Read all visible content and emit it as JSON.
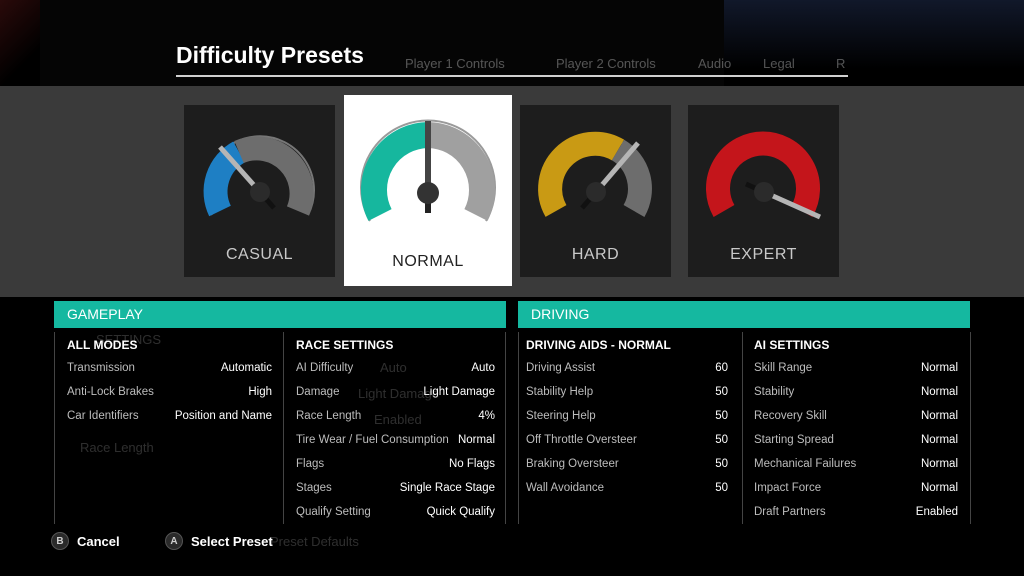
{
  "page": {
    "title": "Difficulty Presets"
  },
  "background": {
    "tabs": [
      "Player 1 Controls",
      "Player 2 Controls",
      "Audio",
      "Legal",
      "R"
    ],
    "ghost_texts": [
      "SETTINGS",
      "Auto",
      "Light Damage",
      "Enabled",
      "Race Length",
      "Preset Defaults"
    ]
  },
  "presets": [
    {
      "label": "CASUAL",
      "color": "#1e7fc4",
      "selected": false
    },
    {
      "label": "NORMAL",
      "color": "#16b79e",
      "selected": true
    },
    {
      "label": "HARD",
      "color": "#c99a14",
      "selected": false
    },
    {
      "label": "EXPERT",
      "color": "#c4151b",
      "selected": false
    }
  ],
  "gameplay": {
    "header": "GAMEPLAY",
    "all_modes": {
      "title": "ALL MODES",
      "rows": [
        {
          "k": "Transmission",
          "v": "Automatic"
        },
        {
          "k": "Anti-Lock Brakes",
          "v": "High"
        },
        {
          "k": "Car Identifiers",
          "v": "Position and Name"
        }
      ]
    },
    "race_settings": {
      "title": "RACE SETTINGS",
      "rows": [
        {
          "k": "AI Difficulty",
          "v": "Auto"
        },
        {
          "k": "Damage",
          "v": "Light Damage"
        },
        {
          "k": "Race Length",
          "v": "4%"
        },
        {
          "k": "Tire Wear / Fuel Consumption",
          "v": "Normal"
        },
        {
          "k": "Flags",
          "v": "No Flags"
        },
        {
          "k": "Stages",
          "v": "Single Race Stage"
        },
        {
          "k": "Qualify Setting",
          "v": "Quick Qualify"
        }
      ]
    }
  },
  "driving": {
    "header": "DRIVING",
    "aids": {
      "title": "DRIVING AIDS - NORMAL",
      "rows": [
        {
          "k": "Driving Assist",
          "v": "60"
        },
        {
          "k": "Stability Help",
          "v": "50"
        },
        {
          "k": "Steering Help",
          "v": "50"
        },
        {
          "k": "Off Throttle Oversteer",
          "v": "50"
        },
        {
          "k": "Braking Oversteer",
          "v": "50"
        },
        {
          "k": "Wall Avoidance",
          "v": "50"
        }
      ]
    },
    "ai_settings": {
      "title": "AI SETTINGS",
      "rows": [
        {
          "k": "Skill Range",
          "v": "Normal"
        },
        {
          "k": "Stability",
          "v": "Normal"
        },
        {
          "k": "Recovery Skill",
          "v": "Normal"
        },
        {
          "k": "Starting Spread",
          "v": "Normal"
        },
        {
          "k": "Mechanical Failures",
          "v": "Normal"
        },
        {
          "k": "Impact Force",
          "v": "Normal"
        },
        {
          "k": "Draft Partners",
          "v": "Enabled"
        }
      ]
    }
  },
  "footer": {
    "cancel": {
      "glyph": "B",
      "label": "Cancel"
    },
    "select": {
      "glyph": "A",
      "label": "Select Preset"
    }
  }
}
